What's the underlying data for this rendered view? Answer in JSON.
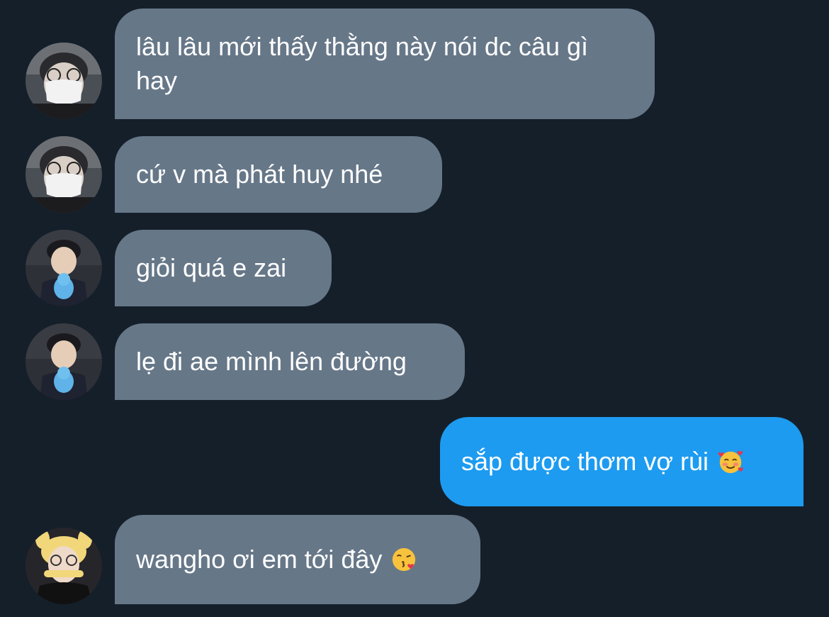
{
  "messages": [
    {
      "sender": "user-glasses-mask",
      "direction": "incoming",
      "text": "lâu lâu mới thấy thằng này nói dc câu gì hay"
    },
    {
      "sender": "user-glasses-mask",
      "direction": "incoming",
      "text": "cứ v mà phát huy nhé"
    },
    {
      "sender": "user-plush",
      "direction": "incoming",
      "text": "giỏi quá e zai"
    },
    {
      "sender": "user-plush",
      "direction": "incoming",
      "text": "lẹ đi ae mình lên đường"
    },
    {
      "sender": "me",
      "direction": "outgoing",
      "text": "sắp được thơm vợ rùi",
      "emoji": "smiling-face-with-hearts-icon"
    },
    {
      "sender": "user-yellow-hood",
      "direction": "incoming",
      "text": "wangho ơi em tới đây",
      "emoji": "face-blowing-kiss-icon"
    }
  ],
  "colors": {
    "background": "#151f2a",
    "incoming_bubble": "#667788",
    "outgoing_bubble": "#1d9bf0",
    "text": "#ffffff"
  }
}
